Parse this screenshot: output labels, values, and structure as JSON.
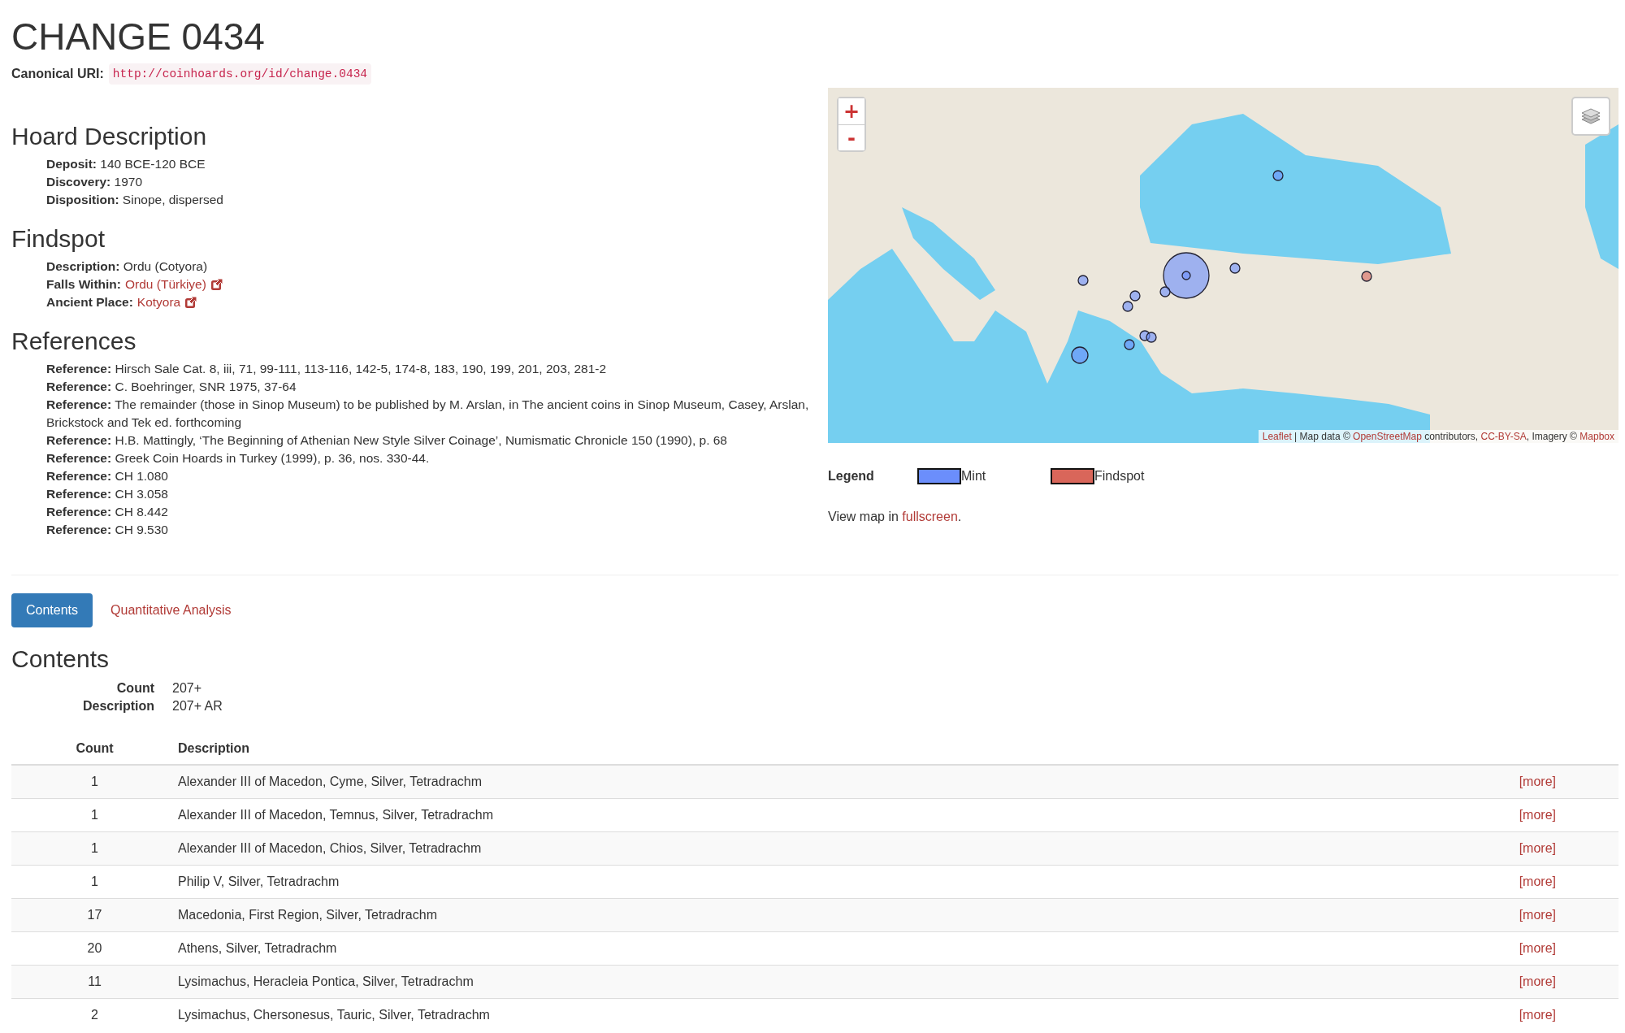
{
  "title": "CHANGE 0434",
  "canonical": {
    "label": "Canonical URI:",
    "uri": "http://coinhoards.org/id/change.0434"
  },
  "sections": [
    {
      "heading": "Hoard Description",
      "fields": [
        {
          "label": "Deposit:",
          "value": "140 BCE-120 BCE",
          "link": false
        },
        {
          "label": "Discovery:",
          "value": "1970",
          "link": false
        },
        {
          "label": "Disposition:",
          "value": "Sinope, dispersed",
          "link": false
        }
      ]
    },
    {
      "heading": "Findspot",
      "fields": [
        {
          "label": "Description:",
          "value": "Ordu (Cotyora)",
          "link": false
        },
        {
          "label": "Falls Within:",
          "value": "Ordu (Türkiye)",
          "link": true
        },
        {
          "label": "Ancient Place:",
          "value": "Kotyora",
          "link": true
        }
      ]
    },
    {
      "heading": "References",
      "fields": [
        {
          "label": "Reference:",
          "value": "Hirsch Sale Cat. 8, iii, 71, 99-111, 113-116, 142-5, 174-8, 183, 190, 199, 201, 203, 281-2",
          "link": false
        },
        {
          "label": "Reference:",
          "value": "C. Boehringer, SNR 1975, 37-64",
          "link": false
        },
        {
          "label": "Reference:",
          "value": "The remainder (those in Sinop Museum) to be published by M. Arslan, in The ancient coins in Sinop Museum, Casey, Arslan, Brickstock and Tek ed. forthcoming",
          "link": false
        },
        {
          "label": "Reference:",
          "value": "H.B. Mattingly, ‘The Beginning of Athenian New Style Silver Coinage’, Numismatic Chronicle 150 (1990), p. 68",
          "link": false
        },
        {
          "label": "Reference:",
          "value": "Greek Coin Hoards in Turkey (1999), p. 36, nos. 330-44.",
          "link": false
        },
        {
          "label": "Reference:",
          "value": "CH 1.080",
          "link": false
        },
        {
          "label": "Reference:",
          "value": "CH 3.058",
          "link": false
        },
        {
          "label": "Reference:",
          "value": "CH 8.442",
          "link": false
        },
        {
          "label": "Reference:",
          "value": "CH 9.530",
          "link": false
        }
      ]
    }
  ],
  "map": {
    "zoom_in": "+",
    "zoom_out": "-",
    "attribution": [
      {
        "text": "Leaflet",
        "link": true
      },
      {
        "text": " | Map data © ",
        "link": false
      },
      {
        "text": "OpenStreetMap",
        "link": true
      },
      {
        "text": " contributors, ",
        "link": false
      },
      {
        "text": "CC-BY-SA",
        "link": true
      },
      {
        "text": ", Imagery © ",
        "link": false
      },
      {
        "text": "Mapbox",
        "link": true
      }
    ]
  },
  "legend": {
    "title": "Legend",
    "items": [
      {
        "label": "Mint",
        "color": "#6b8efc"
      },
      {
        "label": "Findspot",
        "color": "#d9665a"
      }
    ]
  },
  "view_map": [
    {
      "text": "View map in ",
      "link": false
    },
    {
      "text": "fullscreen",
      "link": true
    },
    {
      "text": ".",
      "link": false
    }
  ],
  "tabs": [
    {
      "label": "Contents",
      "selected": true
    },
    {
      "label": "Quantitative Analysis",
      "selected": false
    }
  ],
  "contents": {
    "heading": "Contents",
    "summary": [
      {
        "label": "Count",
        "value": "207+"
      },
      {
        "label": "Description",
        "value": "207+ AR"
      }
    ],
    "columns": [
      "Count",
      "Description"
    ],
    "rows": [
      {
        "count": "1",
        "description": "Alexander III of Macedon, Cyme, Silver, Tetradrachm",
        "more": "[more]"
      },
      {
        "count": "1",
        "description": "Alexander III of Macedon, Temnus, Silver, Tetradrachm",
        "more": "[more]"
      },
      {
        "count": "1",
        "description": "Alexander III of Macedon, Chios, Silver, Tetradrachm",
        "more": "[more]"
      },
      {
        "count": "1",
        "description": "Philip V, Silver, Tetradrachm",
        "more": "[more]"
      },
      {
        "count": "17",
        "description": "Macedonia, First Region, Silver, Tetradrachm",
        "more": "[more]"
      },
      {
        "count": "20",
        "description": "Athens, Silver, Tetradrachm",
        "more": "[more]"
      },
      {
        "count": "11",
        "description": "Lysimachus, Heracleia Pontica, Silver, Tetradrachm",
        "more": "[more]"
      },
      {
        "count": "2",
        "description": "Lysimachus, Chersonesus, Tauric, Silver, Tetradrachm",
        "more": "[more]"
      }
    ]
  }
}
